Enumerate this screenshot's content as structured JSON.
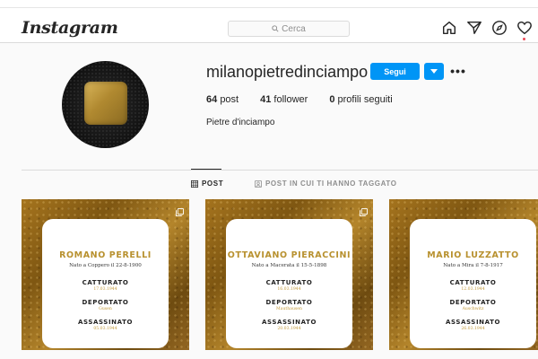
{
  "header": {
    "logo": "Instagram",
    "search_placeholder": "Cerca",
    "icons": [
      "home-icon",
      "direct-icon",
      "explore-icon",
      "activity-heart-icon"
    ]
  },
  "profile": {
    "username": "milanopietredinciampo",
    "follow_label": "Segui",
    "more_label": "•••",
    "stats": {
      "posts_count": "64",
      "posts_label": "post",
      "followers_count": "41",
      "followers_label": "follower",
      "following_count": "0",
      "following_label": "profili seguiti"
    },
    "full_name": "Pietre d'inciampo"
  },
  "tabs": [
    {
      "label": "POST",
      "active": true,
      "icon": "grid-icon"
    },
    {
      "label": "POST IN CUI TI HANNO TAGGATO",
      "active": false,
      "icon": "tag-person-icon"
    }
  ],
  "posts": [
    {
      "name": "ROMANO PERELLI",
      "birth": "Nato a Coppero il 22-8-1900",
      "captured_label": "CATTURATO",
      "captured_date": "17.03.1944",
      "deported_label": "DEPORTATO",
      "deported_place": "Gusen",
      "killed_label": "ASSASSINATO",
      "killed_date": "05.03.1944"
    },
    {
      "name": "OTTAVIANO PIERACCINI",
      "birth": "Nato a Macerata il 15-5-1898",
      "captured_label": "CATTURATO",
      "captured_date": "16.03.1944",
      "deported_label": "DEPORTATO",
      "deported_place": "Mauthausen",
      "killed_label": "ASSASSINATO",
      "killed_date": "20.03.1944"
    },
    {
      "name": "MARIO LUZZATTO",
      "birth": "Nato a Mira il 7-8-1917",
      "captured_label": "CATTURATO",
      "captured_date": "12.03.1944",
      "deported_label": "DEPORTATO",
      "deported_place": "Auschwitz",
      "killed_label": "ASSASSINATO",
      "killed_date": "26.03.1944"
    }
  ],
  "colors": {
    "accent_blue": "#0095f6",
    "gold": "#b8912f",
    "notification_red": "#ed4956"
  }
}
